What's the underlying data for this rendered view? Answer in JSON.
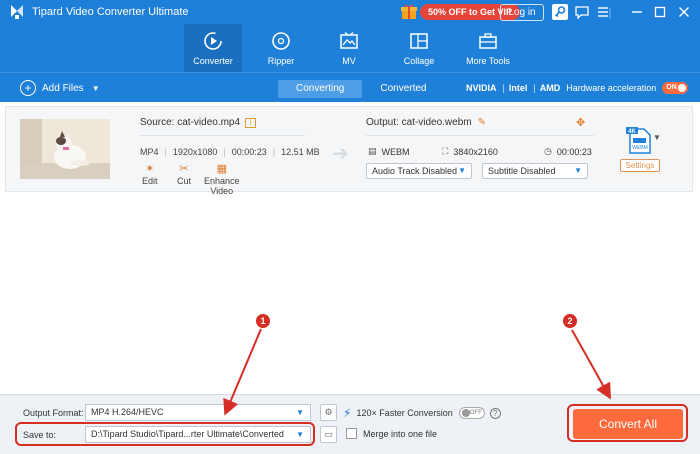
{
  "titlebar": {
    "app_title": "Tipard Video Converter Ultimate",
    "promo_text": "50% OFF to Get VIP",
    "login_label": "Log in"
  },
  "nav": {
    "tabs": [
      {
        "label": "Converter",
        "icon": "converter-icon"
      },
      {
        "label": "Ripper",
        "icon": "dvd-icon"
      },
      {
        "label": "MV",
        "icon": "mv-icon"
      },
      {
        "label": "Collage",
        "icon": "collage-icon"
      },
      {
        "label": "More Tools",
        "icon": "toolbox-icon"
      }
    ],
    "active_index": 0
  },
  "toolbar": {
    "add_files_label": "Add Files",
    "segments": [
      "Converting",
      "Converted"
    ],
    "active_segment": 0,
    "gpu_vendors": [
      "NVIDIA",
      "Intel",
      "AMD"
    ],
    "hw_accel_label": "Hardware acceleration",
    "hw_accel_state": "ON"
  },
  "file": {
    "source_label": "Source: cat-video.mp4",
    "src_format": "MP4",
    "src_resolution": "1920x1080",
    "src_duration": "00:00:23",
    "src_size": "12.51 MB",
    "tools": [
      "Edit",
      "Cut",
      "Enhance Video"
    ],
    "output_label": "Output: cat-video.webm",
    "out_format": "WEBM",
    "out_resolution": "3840x2160",
    "out_duration": "00:00:23",
    "audio_track": "Audio Track Disabled",
    "subtitle": "Subtitle Disabled",
    "format_badge_top": "4K",
    "format_badge_bottom": "WEBM",
    "settings_label": "Settings"
  },
  "bottom": {
    "output_format_label": "Output Format:",
    "output_format_value": "MP4 H.264/HEVC",
    "save_to_label": "Save to:",
    "save_to_value": "D:\\Tipard Studio\\Tipard...rter Ultimate\\Converted",
    "speed_label": "120× Faster Conversion",
    "speed_state": "OFF",
    "merge_label": "Merge into one file",
    "convert_label": "Convert All"
  },
  "annotations": {
    "callout_1": "1",
    "callout_2": "2"
  },
  "colors": {
    "brand_blue": "#1f80d9",
    "accent_orange": "#ff6a3d",
    "annotation_red": "#d62d25"
  }
}
